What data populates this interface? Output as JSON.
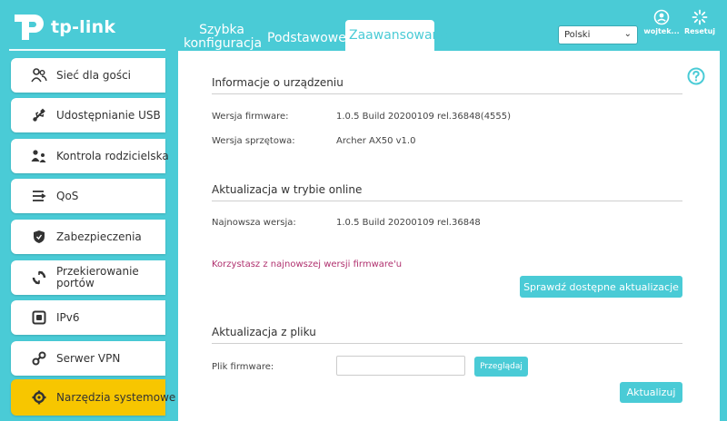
{
  "brand": {
    "name": "tp-link"
  },
  "nav": {
    "tabs": [
      {
        "label": "Szybka konfiguracja"
      },
      {
        "label": "Podstawowe"
      },
      {
        "label": "Zaawansowane"
      }
    ]
  },
  "language": {
    "selected": "Polski"
  },
  "top_actions": {
    "user_label": "wojtek...",
    "reset_label": "Resetuj"
  },
  "sidebar": {
    "items": [
      {
        "label": "Sieć dla gości",
        "icon": "guests-icon"
      },
      {
        "label": "Udostępnianie USB",
        "icon": "usb-icon"
      },
      {
        "label": "Kontrola rodzicielska",
        "icon": "parental-icon"
      },
      {
        "label": "QoS",
        "icon": "qos-icon"
      },
      {
        "label": "Zabezpieczenia",
        "icon": "shield-icon"
      },
      {
        "label": "Przekierowanie portów",
        "icon": "forwarding-icon"
      },
      {
        "label": "IPv6",
        "icon": "ipv6-icon"
      },
      {
        "label": "Serwer VPN",
        "icon": "vpn-icon"
      },
      {
        "label": "Narzędzia systemowe",
        "icon": "tools-icon"
      }
    ]
  },
  "device_info": {
    "title": "Informacje o urządzeniu",
    "firmware_label": "Wersja firmware:",
    "firmware_value": "1.0.5 Build 20200109 rel.36848(4555)",
    "hardware_label": "Wersja sprzętowa:",
    "hardware_value": "Archer AX50 v1.0"
  },
  "online_update": {
    "title": "Aktualizacja w trybie online",
    "latest_label": "Najnowsza wersja:",
    "latest_value": "1.0.5 Build 20200109 rel.36848",
    "status_note": "Korzystasz z najnowszej wersji firmware'u",
    "check_button": "Sprawdź dostępne aktualizacje"
  },
  "file_update": {
    "title": "Aktualizacja z pliku",
    "file_label": "Plik firmware:",
    "browse_button": "Przeglądaj",
    "update_button": "Aktualizuj"
  },
  "colors": {
    "accent": "#4acbd6",
    "active": "#f7c600",
    "note": "#b0306e"
  }
}
